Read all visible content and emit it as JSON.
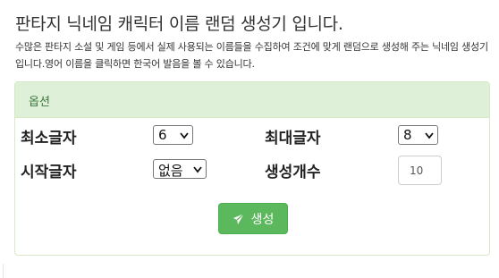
{
  "page": {
    "title": "판타지 닉네임 캐릭터 이름 랜덤 생성기 입니다.",
    "description": "수많은 판타지 소설 및 게임 등에서 실제 사용되는 이름들을 수집하여 조건에 맞게 랜덤으로 생성해 주는 닉네임 생성기입니다.영어 이름을 클릭하면 한국어 발음을 볼 수 있습니다."
  },
  "options": {
    "header": "옵션",
    "min_chars_label": "최소글자",
    "min_chars_value": "6",
    "max_chars_label": "최대글자",
    "max_chars_value": "8",
    "start_char_label": "시작글자",
    "start_char_value": "없음",
    "count_label": "생성개수",
    "count_value": "10"
  },
  "generate_button": {
    "label": "생성",
    "icon": "send-icon"
  },
  "colors": {
    "panel_header_bg": "#dff0d8",
    "panel_header_text": "#3c763d",
    "panel_border": "#d6e9c6",
    "button_bg": "#5cb85c"
  }
}
